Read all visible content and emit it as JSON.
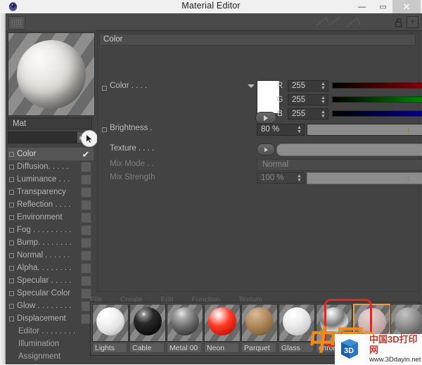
{
  "window": {
    "title": "Material Editor",
    "logo_icon": "cinema4d-logo-icon",
    "minimize_label": "—",
    "maximize_label": "▭",
    "close_label": "✕"
  },
  "toolbar": {
    "grip_icon": "drag-grip-icon",
    "lock_icon": "lock-open-icon",
    "lock_label": "",
    "add_icon": "plus-box-icon",
    "add_label": "+"
  },
  "preview": {
    "material_name": "Mat",
    "search_value": "",
    "search_arrow_label": "▶",
    "cursor_icon": "mouse-pointer-icon"
  },
  "channels": [
    {
      "label": "Color",
      "selected": true,
      "checked": true,
      "has_box": true
    },
    {
      "label": "Diffusion. . . . .",
      "selected": false,
      "checked": false,
      "has_box": true
    },
    {
      "label": "Luminance  . . .",
      "selected": false,
      "checked": false,
      "has_box": true
    },
    {
      "label": "Transparency",
      "selected": false,
      "checked": false,
      "has_box": true
    },
    {
      "label": "Reflection . . . .",
      "selected": false,
      "checked": false,
      "has_box": true
    },
    {
      "label": "Environment",
      "selected": false,
      "checked": false,
      "has_box": true
    },
    {
      "label": "Fog . . . . . . . . .",
      "selected": false,
      "checked": false,
      "has_box": true
    },
    {
      "label": "Bump. . . . . . . .",
      "selected": false,
      "checked": false,
      "has_box": true
    },
    {
      "label": "Normal  . . . . . .",
      "selected": false,
      "checked": false,
      "has_box": true
    },
    {
      "label": "Alpha. . . . . . . .",
      "selected": false,
      "checked": false,
      "has_box": true
    },
    {
      "label": "Specular  . . . . .",
      "selected": false,
      "checked": false,
      "has_box": true
    },
    {
      "label": "Specular Color",
      "selected": false,
      "checked": false,
      "has_box": true
    },
    {
      "label": "Glow . . . . . . . .",
      "selected": false,
      "checked": false,
      "has_box": true
    },
    {
      "label": "Displacement",
      "selected": false,
      "checked": false,
      "has_box": true
    }
  ],
  "channels_plain": [
    {
      "label": "Editor  . . . . . . . ."
    },
    {
      "label": "Illumination"
    },
    {
      "label": "Assignment"
    }
  ],
  "color_section": {
    "header": "Color",
    "color_label": "Color . . . .",
    "swatch_hex": "#ffffff",
    "rgb": [
      {
        "letter": "R",
        "value": "255",
        "from": "#000000",
        "to": "#ff0000",
        "marker_pct": 100
      },
      {
        "letter": "G",
        "value": "255",
        "from": "#000000",
        "to": "#00ff00",
        "marker_pct": 100
      },
      {
        "letter": "B",
        "value": "255",
        "from": "#000000",
        "to": "#0000ff",
        "marker_pct": 100
      }
    ],
    "brightness_label": "Brightness .",
    "brightness_value": "80 %",
    "brightness_pct": 80,
    "texture_label": "Texture  . . . .",
    "texture_value": "",
    "texture_browse_label": "...",
    "mix_mode_label": "Mix Mode . .",
    "mix_mode_value": "Normal",
    "mix_strength_label": "Mix Strength",
    "mix_strength_value": "100 %",
    "mix_strength_pct": 100,
    "accent_hex": "#f0a500"
  },
  "menubar": [
    "File",
    "Create",
    "Edit",
    "Function",
    "Texture"
  ],
  "materials": [
    {
      "name": "Lights",
      "ball": "radial-gradient(circle at 33% 26%, #ffffff 0%, #f5f5f5 30%, #e3e3e3 58%, #bdbdbd 82%, #8f8f8f 100%)",
      "selected": false
    },
    {
      "name": "Cable",
      "ball": "radial-gradient(circle at 36% 24%, #f3f3f3 0%, #8d8d8d 9%, #2a2a2a 34%, #111111 70%, #050505 100%)",
      "selected": false
    },
    {
      "name": "Metal 00",
      "ball": "radial-gradient(circle at 38% 22%, #e8e8e8 0%, #a8a8a8 20%, #6a6a6a 50%, #3a3a3a 80%, #1e1e1e 100%)",
      "selected": false
    },
    {
      "name": "Neon",
      "ball": "radial-gradient(circle at 36% 26%, #ffffff 0%, #ffd0cc 12%, #ff3b26 42%, #cc1506 78%, #8c0c02 100%)",
      "selected": false
    },
    {
      "name": "Parquet",
      "ball": "radial-gradient(circle at 36% 24%, #d7bb93 0%, #b89268 35%, #8d6a42 70%, #5c4326 100%)",
      "selected": false
    },
    {
      "name": "Glass",
      "ball": "radial-gradient(circle at 36% 26%, #ffffff 0%, #f0f0f0 35%, #d6d6d6 65%, #ababab 100%)",
      "selected": false
    },
    {
      "name": "chrome",
      "ball": "radial-gradient(circle at 40% 20%, #ffffff 0%, #c9c9c9 18%, #787878 45%, #d8d8d8 64%, #454545 88%, #222222 100%)",
      "selected": false
    },
    {
      "name": "",
      "ball": "radial-gradient(circle at 36% 26%, #e8d3d0 0%, #d7bdb9 35%, #c0a3a0 68%, #9c8380 100%)",
      "selected": true
    },
    {
      "name": "",
      "ball": "radial-gradient(circle at 36% 24%, #c4c4c4 0%, #9a9a9a 35%, #6b6b6b 70%, #434343 100%)",
      "selected": false
    }
  ],
  "selection_highlight_hex": "#e8241c",
  "watermark": {
    "logo_text": "3D",
    "title": "中国3D打印网",
    "url": "www.3Ddayin.net",
    "overlay_glyphs": "china"
  }
}
